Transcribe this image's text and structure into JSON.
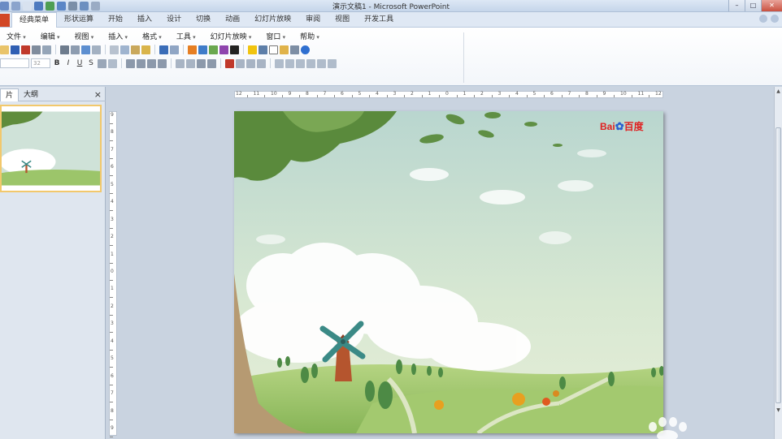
{
  "window": {
    "title": "演示文稿1 - Microsoft PowerPoint",
    "buttons": [
      "–",
      "□",
      "✕"
    ]
  },
  "ribbon_tabs": [
    {
      "label": "经典菜单",
      "active": true
    },
    {
      "label": "形状运算",
      "active": false
    },
    {
      "label": "开始",
      "active": false
    },
    {
      "label": "插入",
      "active": false
    },
    {
      "label": "设计",
      "active": false
    },
    {
      "label": "切换",
      "active": false
    },
    {
      "label": "动画",
      "active": false
    },
    {
      "label": "幻灯片放映",
      "active": false
    },
    {
      "label": "审阅",
      "active": false
    },
    {
      "label": "视图",
      "active": false
    },
    {
      "label": "开发工具",
      "active": false
    }
  ],
  "classic_menus": [
    "文件",
    "编辑",
    "视图",
    "插入",
    "格式",
    "工具",
    "幻灯片放映",
    "窗口",
    "帮助"
  ],
  "format_toolbar": {
    "font_size": "32",
    "bold": "B",
    "italic": "I",
    "underline": "U",
    "strike": "S"
  },
  "left_panel": {
    "tab_slides": "片",
    "tab_outline": "大纲",
    "close": "×"
  },
  "rulers": {
    "horizontal_labels": [
      "12",
      "11",
      "10",
      "9",
      "8",
      "7",
      "6",
      "5",
      "4",
      "3",
      "2",
      "1",
      "0",
      "1",
      "2",
      "3",
      "4",
      "5",
      "6",
      "7",
      "8",
      "9",
      "10",
      "11",
      "12"
    ],
    "vertical_labels": [
      "9",
      "8",
      "7",
      "6",
      "5",
      "4",
      "3",
      "2",
      "1",
      "0",
      "1",
      "2",
      "3",
      "4",
      "5",
      "6",
      "7",
      "8",
      "9"
    ]
  },
  "slide": {
    "logo_text": "Bai",
    "logo_text2": "百度",
    "colors": {
      "sky": "#c9dfd6",
      "grass": "#9cc56a",
      "cloud": "#ffffff",
      "windmill": "#3b8a86",
      "tower": "#b5552e"
    }
  }
}
